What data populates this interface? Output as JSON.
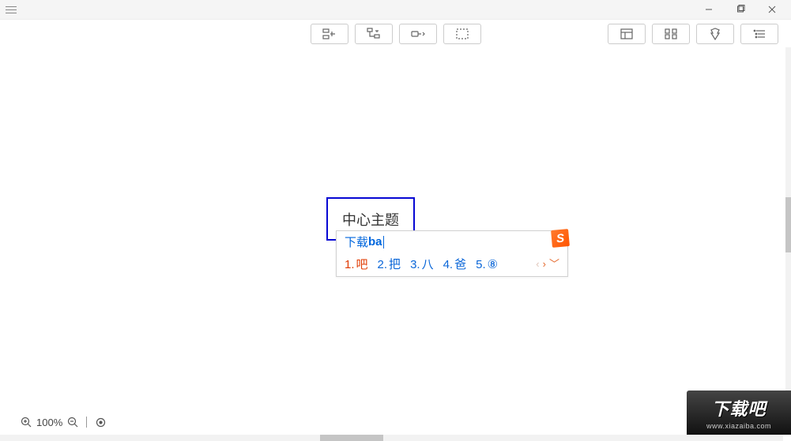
{
  "node": {
    "label": "中心主题"
  },
  "ime": {
    "prefix": "下载",
    "typed": "ba",
    "logo": "S",
    "candidates": [
      {
        "num": "1.",
        "ch": "吧"
      },
      {
        "num": "2.",
        "ch": "把"
      },
      {
        "num": "3.",
        "ch": "八"
      },
      {
        "num": "4.",
        "ch": "爸"
      },
      {
        "num": "5.",
        "ch": "⑧"
      }
    ]
  },
  "status": {
    "zoom": "100%"
  },
  "watermark": {
    "main": "下载吧",
    "sub": "www.xiazaiba.com"
  }
}
